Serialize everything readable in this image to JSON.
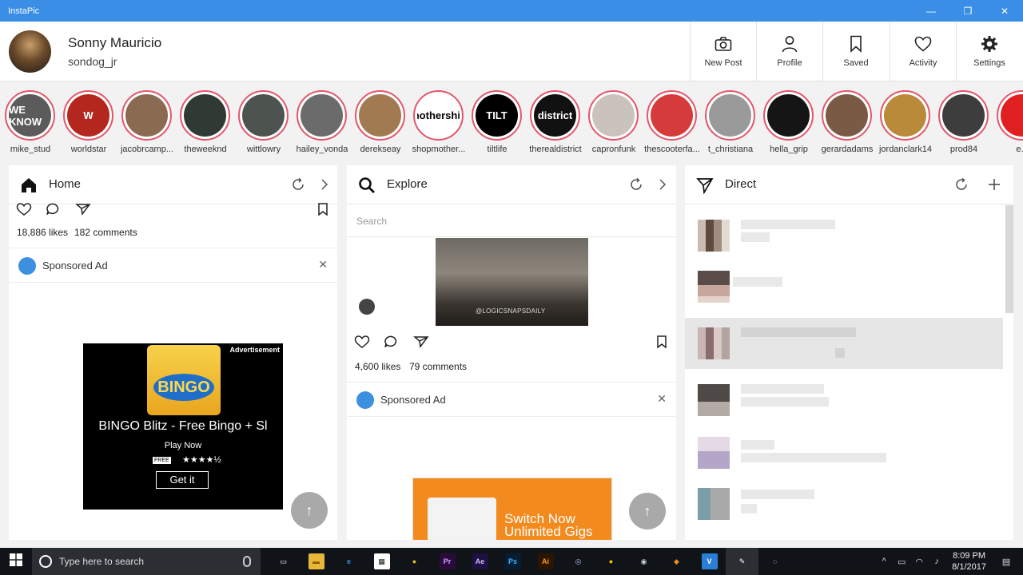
{
  "window": {
    "title": "InstaPic",
    "minimize_glyph": "—",
    "maximize_glyph": "❐",
    "close_glyph": "✕"
  },
  "user": {
    "name": "Sonny Mauricio",
    "handle": "sondog_jr"
  },
  "nav": [
    {
      "id": "new-post",
      "label": "New Post",
      "icon": "camera-icon"
    },
    {
      "id": "profile",
      "label": "Profile",
      "icon": "person-icon"
    },
    {
      "id": "saved",
      "label": "Saved",
      "icon": "bookmark-icon"
    },
    {
      "id": "activity",
      "label": "Activity",
      "icon": "heart-icon"
    },
    {
      "id": "settings",
      "label": "Settings",
      "icon": "gear-icon"
    }
  ],
  "stories": [
    {
      "name": "mike_stud",
      "color": "#5b5b5b",
      "text": "WE KNOW"
    },
    {
      "name": "worldstar",
      "color": "#b3271e",
      "text": "W"
    },
    {
      "name": "jacobrcamp...",
      "color": "#8a6a50",
      "text": ""
    },
    {
      "name": "theweeknd",
      "color": "#2f3a35",
      "text": ""
    },
    {
      "name": "wittlowry",
      "color": "#4d534e",
      "text": ""
    },
    {
      "name": "hailey_vonda",
      "color": "#6b6b6b",
      "text": ""
    },
    {
      "name": "derekseay",
      "color": "#a27a52",
      "text": ""
    },
    {
      "name": "shopmother...",
      "color": "#ffffff",
      "text": "mothership"
    },
    {
      "name": "tiltlife",
      "color": "#000000",
      "text": "TILT"
    },
    {
      "name": "therealdistrict",
      "color": "#111111",
      "text": "district"
    },
    {
      "name": "capronfunk",
      "color": "#c9c3bb",
      "text": ""
    },
    {
      "name": "thescooterfa...",
      "color": "#d63b3b",
      "text": ""
    },
    {
      "name": "t_christiana",
      "color": "#9a9a9a",
      "text": ""
    },
    {
      "name": "hella_grip",
      "color": "#151515",
      "text": ""
    },
    {
      "name": "gerardadams",
      "color": "#7b5a45",
      "text": ""
    },
    {
      "name": "jordanclark14",
      "color": "#b98a3a",
      "text": ""
    },
    {
      "name": "prod84",
      "color": "#3d3d3d",
      "text": ""
    },
    {
      "name": "e...",
      "color": "#e02020",
      "text": ""
    }
  ],
  "home": {
    "title": "Home",
    "likes": "18,886 likes",
    "comments": "182 comments",
    "sponsored_label": "Sponsored Ad",
    "close_glyph": "✕",
    "ad": {
      "tag": "Advertisement",
      "logo_text": "BINGO",
      "title": "BINGO Blitz - Free Bingo + Sl",
      "cta": "Play Now",
      "free_badge": "FREE",
      "rating": "★★★★½",
      "button": "Get it"
    },
    "fab_glyph": "↑"
  },
  "explore": {
    "title": "Explore",
    "search_placeholder": "Search",
    "media_watermark": "@LOGICSNAPSDAILY",
    "likes": "4,600 likes",
    "comments": "79 comments",
    "sponsored_label": "Sponsored Ad",
    "close_glyph": "✕",
    "ad": {
      "line1": "Switch Now",
      "line2": "Unlimited Gigs"
    },
    "fab_glyph": "↑"
  },
  "direct": {
    "title": "Direct"
  },
  "taskbar": {
    "search_placeholder": "Type here to search",
    "apps": [
      {
        "name": "task-view",
        "label": "▭",
        "bg": "#101418",
        "fg": "#ffffff"
      },
      {
        "name": "file-explorer",
        "label": "▬",
        "bg": "#e8b739",
        "fg": "#8a5b00"
      },
      {
        "name": "edge",
        "label": "e",
        "bg": "#101418",
        "fg": "#2e8ee6"
      },
      {
        "name": "store",
        "label": "▦",
        "bg": "#ffffff",
        "fg": "#101418"
      },
      {
        "name": "chrome",
        "label": "●",
        "bg": "#101418",
        "fg": "#e4bb2a"
      },
      {
        "name": "premiere",
        "label": "Pr",
        "bg": "#2a0b3c",
        "fg": "#d59cff"
      },
      {
        "name": "after-effects",
        "label": "Ae",
        "bg": "#1e1040",
        "fg": "#cab5ff"
      },
      {
        "name": "photoshop",
        "label": "Ps",
        "bg": "#071d34",
        "fg": "#41b4ff"
      },
      {
        "name": "illustrator",
        "label": "Ai",
        "bg": "#2c1500",
        "fg": "#ff9a1e"
      },
      {
        "name": "app-spiral",
        "label": "◎",
        "bg": "#101418",
        "fg": "#b9b9ff"
      },
      {
        "name": "app-yellow",
        "label": "●",
        "bg": "#101418",
        "fg": "#f5c400"
      },
      {
        "name": "steam",
        "label": "◉",
        "bg": "#101418",
        "fg": "#c6d4df"
      },
      {
        "name": "fl-studio",
        "label": "◆",
        "bg": "#101418",
        "fg": "#f58c1e"
      },
      {
        "name": "app-v",
        "label": "V",
        "bg": "#2b7ed6",
        "fg": "#ffffff"
      },
      {
        "name": "instapic",
        "label": "✎",
        "bg": "#2b2f33",
        "fg": "#ffffff"
      },
      {
        "name": "obs",
        "label": "◌",
        "bg": "#101418",
        "fg": "#ffffff"
      }
    ],
    "tray_icons": [
      "^",
      "▭",
      "◠",
      "♪"
    ],
    "time": "8:09 PM",
    "date": "8/1/2017",
    "notification_glyph": "▤"
  }
}
